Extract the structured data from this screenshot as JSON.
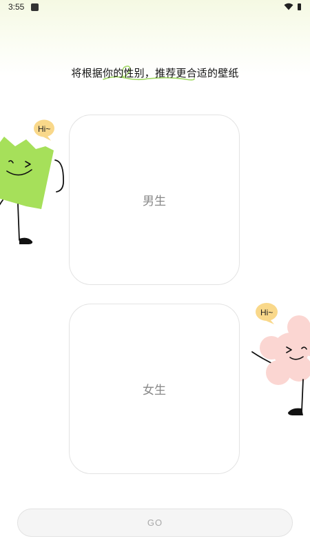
{
  "status_bar": {
    "time": "3:55",
    "icons": [
      "notification-icon",
      "wifi-icon",
      "battery-icon"
    ]
  },
  "header": {
    "title": "将根据你的性别，推荐更合适的壁纸"
  },
  "options": {
    "male_label": "男生",
    "female_label": "女生"
  },
  "mascots": {
    "green_bubble": "Hi~",
    "pink_bubble": "Hi~"
  },
  "actions": {
    "go_label": "GO"
  },
  "colors": {
    "mascot_green": "#a6e05a",
    "mascot_pink": "#fbd6d2",
    "bubble_yellow": "#f9d88a",
    "underline_green": "#9ed85f",
    "button_bg": "#f5f5f5",
    "card_border": "#e3e3e3"
  }
}
